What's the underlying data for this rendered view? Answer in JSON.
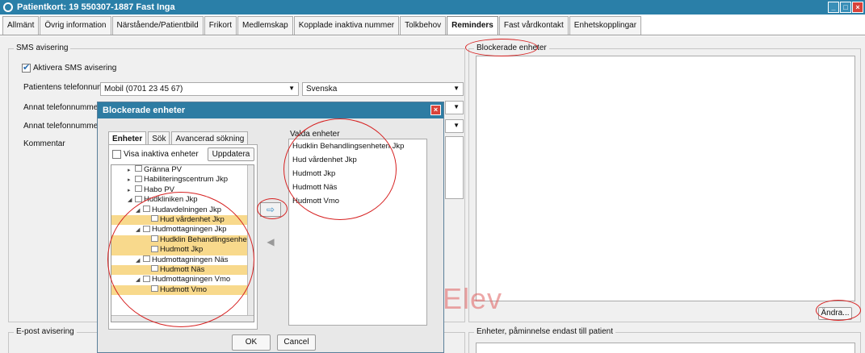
{
  "window": {
    "title": "Patientkort: 19 550307-1887 Fast Inga"
  },
  "tabs": [
    {
      "label": "Allmänt",
      "active": false
    },
    {
      "label": "Övrig information",
      "active": false
    },
    {
      "label": "Närstående/Patientbild",
      "active": false
    },
    {
      "label": "Frikort",
      "active": false
    },
    {
      "label": "Medlemskap",
      "active": false
    },
    {
      "label": "Kopplade inaktiva nummer",
      "active": false
    },
    {
      "label": "Tolkbehov",
      "active": false
    },
    {
      "label": "Reminders",
      "active": true
    },
    {
      "label": "Fast vårdkontakt",
      "active": false
    },
    {
      "label": "Enhetskopplingar",
      "active": false
    }
  ],
  "sms": {
    "legend": "SMS avisering",
    "activate_label": "Aktivera SMS avisering",
    "phone_label": "Patientens telefonnummer",
    "phone_value": "Mobil (0701 23 45 67)",
    "language_value": "Svenska",
    "other_phone_label_1": "Annat telefonnummer",
    "other_phone_label_2": "Annat telefonnummer",
    "comment_label": "Kommentar"
  },
  "blocked": {
    "legend": "Blockerade enheter",
    "change_button": "Ändra..."
  },
  "email": {
    "legend": "E-post avisering"
  },
  "reminder_units": {
    "legend": "Enheter, påminnelse endast till patient"
  },
  "watermark": "Elev",
  "dialog": {
    "title": "Blockerade enheter",
    "tabs": [
      {
        "label": "Enheter",
        "active": true
      },
      {
        "label": "Sök",
        "active": false
      },
      {
        "label": "Avancerad sökning",
        "active": false
      }
    ],
    "show_inactive_label": "Visa inaktiva enheter",
    "update_button": "Uppdatera",
    "tree": [
      {
        "label": "Gränna PV",
        "indent": 2,
        "toggle": "▸",
        "selected": false
      },
      {
        "label": "Habiliteringscentrum Jkp",
        "indent": 2,
        "toggle": "▸",
        "selected": false
      },
      {
        "label": "Habo PV",
        "indent": 2,
        "toggle": "▸",
        "selected": false
      },
      {
        "label": "Hudkliniken Jkp",
        "indent": 2,
        "toggle": "◢",
        "selected": false
      },
      {
        "label": "Hudavdelningen Jkp",
        "indent": 3,
        "toggle": "◢",
        "selected": false
      },
      {
        "label": "Hud vårdenhet Jkp",
        "indent": 4,
        "toggle": "",
        "selected": true
      },
      {
        "label": "Hudmottagningen Jkp",
        "indent": 3,
        "toggle": "◢",
        "selected": false
      },
      {
        "label": "Hudklin Behandlingsenheten ...",
        "indent": 4,
        "toggle": "",
        "selected": true
      },
      {
        "label": "Hudmott Jkp",
        "indent": 4,
        "toggle": "",
        "selected": true
      },
      {
        "label": "Hudmottagningen Näs",
        "indent": 3,
        "toggle": "◢",
        "selected": false
      },
      {
        "label": "Hudmott Näs",
        "indent": 4,
        "toggle": "",
        "selected": true
      },
      {
        "label": "Hudmottagningen Vmo",
        "indent": 3,
        "toggle": "◢",
        "selected": false
      },
      {
        "label": "Hudmott Vmo",
        "indent": 4,
        "toggle": "",
        "selected": true
      }
    ],
    "valda_label": "Valda enheter",
    "valda_items": [
      "Hudklin Behandlingsenheten Jkp",
      "Hud vårdenhet Jkp",
      "Hudmott Jkp",
      "Hudmott Näs",
      "Hudmott Vmo"
    ],
    "ok_button": "OK",
    "cancel_button": "Cancel"
  },
  "colors": {
    "titlebar": "#2a7fa8",
    "selection": "#f8d98c",
    "annotation": "#d62020"
  }
}
